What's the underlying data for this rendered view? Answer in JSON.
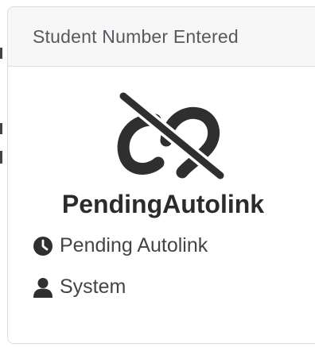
{
  "card": {
    "header_title": "Student Number Entered",
    "status_title": "PendingAutolink",
    "meta": {
      "status_icon": "clock-icon",
      "status_text": "Pending Autolink",
      "user_icon": "user-icon",
      "user_text": "System"
    },
    "main_icon": "unlink-icon"
  }
}
